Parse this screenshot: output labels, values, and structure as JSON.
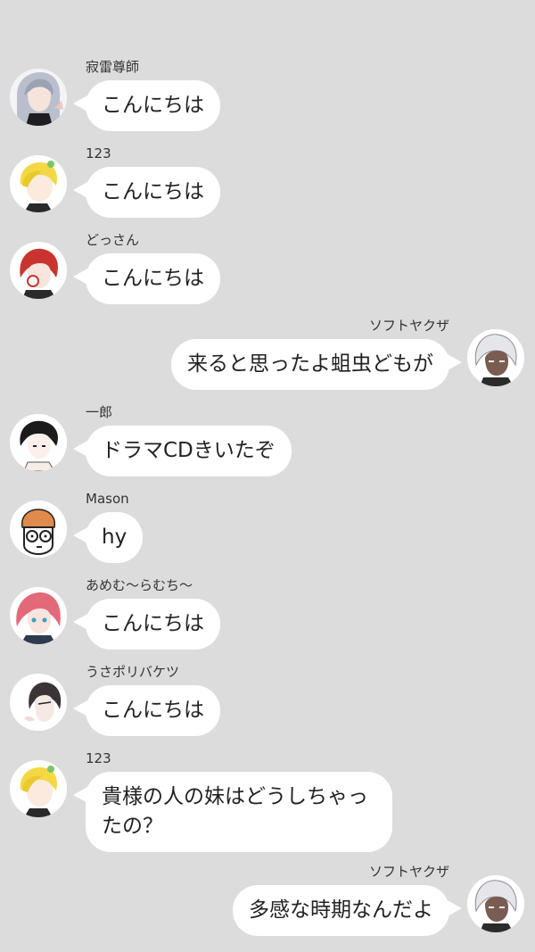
{
  "messages": [
    {
      "side": "left",
      "name": "寂雷尊師",
      "text": "こんにちは",
      "avatar": "silver-long-hair-avatar"
    },
    {
      "side": "left",
      "name": "123",
      "text": "こんにちは",
      "avatar": "blonde-boy-avatar"
    },
    {
      "side": "left",
      "name": "どっさん",
      "text": "こんにちは",
      "avatar": "red-hair-avatar"
    },
    {
      "side": "right",
      "name": "ソフトヤクザ",
      "text": "来ると思ったよ蛆虫どもが",
      "avatar": "white-hair-avatar"
    },
    {
      "side": "left",
      "name": "一郎",
      "text": "ドラマCDきいたぞ",
      "avatar": "black-hair-avatar"
    },
    {
      "side": "left",
      "name": "Mason",
      "text": "hy",
      "avatar": "cartoon-glasses-avatar"
    },
    {
      "side": "left",
      "name": "あめむ〜らむち〜",
      "text": "こんにちは",
      "avatar": "pink-hair-avatar"
    },
    {
      "side": "left",
      "name": "うさポリバケツ",
      "text": "こんにちは",
      "avatar": "dark-hair-profile-avatar"
    },
    {
      "side": "left",
      "name": "123",
      "text": "貴様の人の妹はどうしちゃったの？",
      "avatar": "blonde-boy-avatar"
    },
    {
      "side": "right",
      "name": "ソフトヤクザ",
      "text": "多感な時期なんだよ",
      "avatar": "white-hair-avatar"
    }
  ],
  "colors": {
    "background": "#dcdcdc",
    "bubble": "#ffffff",
    "name_text": "#333333",
    "message_text": "#222222"
  }
}
